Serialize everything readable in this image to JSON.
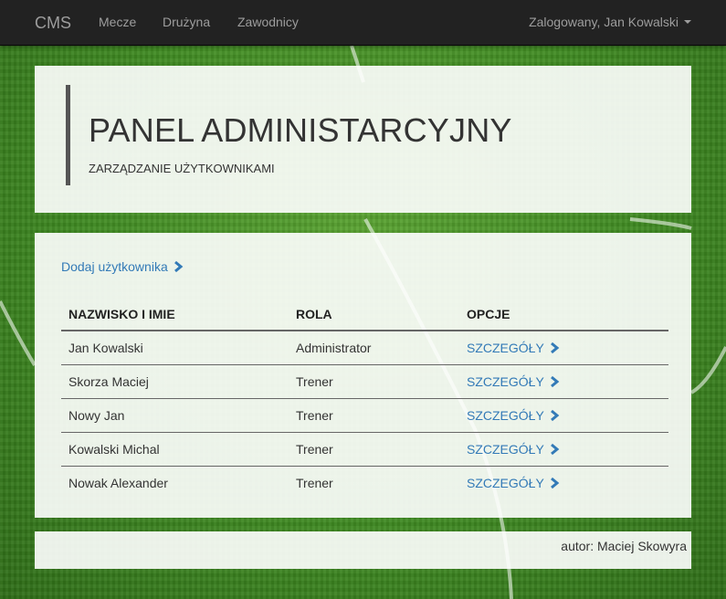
{
  "navbar": {
    "brand": "CMS",
    "links": [
      "Mecze",
      "Drużyna",
      "Zawodnicy"
    ],
    "user": "Zalogowany, Jan Kowalski"
  },
  "header": {
    "title": "PANEL ADMINISTARCYJNY",
    "subtitle": "ZARZĄDZANIE UŻYTKOWNIKAMI"
  },
  "main": {
    "add_user_label": "Dodaj użytkownika",
    "columns": [
      "NAZWISKO I IMIE",
      "ROLA",
      "OPCJE"
    ],
    "rows": [
      {
        "name": "Jan Kowalski",
        "role": "Administrator",
        "option": "SZCZEGÓŁY"
      },
      {
        "name": "Skorza Maciej",
        "role": "Trener",
        "option": "SZCZEGÓŁY"
      },
      {
        "name": "Nowy Jan",
        "role": "Trener",
        "option": "SZCZEGÓŁY"
      },
      {
        "name": "Kowalski Michal",
        "role": "Trener",
        "option": "SZCZEGÓŁY"
      },
      {
        "name": "Nowak Alexander",
        "role": "Trener",
        "option": "SZCZEGÓŁY"
      }
    ]
  },
  "footer": {
    "author": "autor: Maciej Skowyra"
  },
  "colors": {
    "accent": "#337ab7",
    "navbar": "#222222",
    "grass": "#3f8a22"
  },
  "icons": {
    "chevron": "chevron-right-icon",
    "caret": "caret-down-icon"
  }
}
